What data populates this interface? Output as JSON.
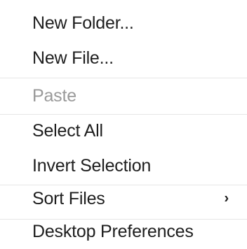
{
  "menu": {
    "items": [
      {
        "label": "New Folder..."
      },
      {
        "label": "New File..."
      },
      {
        "label": "Paste"
      },
      {
        "label": "Select All"
      },
      {
        "label": "Invert Selection"
      },
      {
        "label": "Sort Files"
      },
      {
        "label": "Desktop Preferences"
      }
    ],
    "submenu_arrow": "›"
  },
  "colors": {
    "text": "#1e1e1e",
    "disabled_text": "#9a9a9a",
    "separator": "#e6e6e6",
    "background": "#ffffff"
  },
  "icons": {
    "submenu": "chevron-right-icon"
  }
}
